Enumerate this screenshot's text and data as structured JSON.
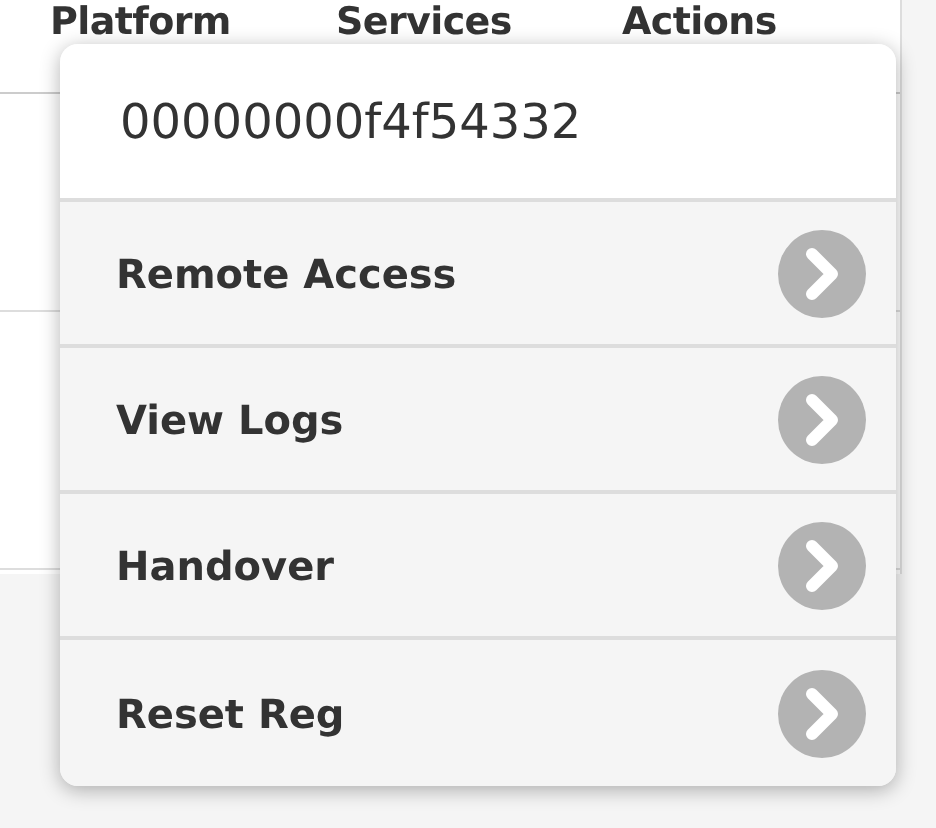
{
  "table": {
    "columns": [
      "Platform",
      "Services",
      "Actions"
    ]
  },
  "menu": {
    "title": "00000000f4f54332",
    "items": [
      {
        "label": "Remote Access"
      },
      {
        "label": "View Logs"
      },
      {
        "label": "Handover"
      },
      {
        "label": "Reset Reg"
      }
    ]
  }
}
